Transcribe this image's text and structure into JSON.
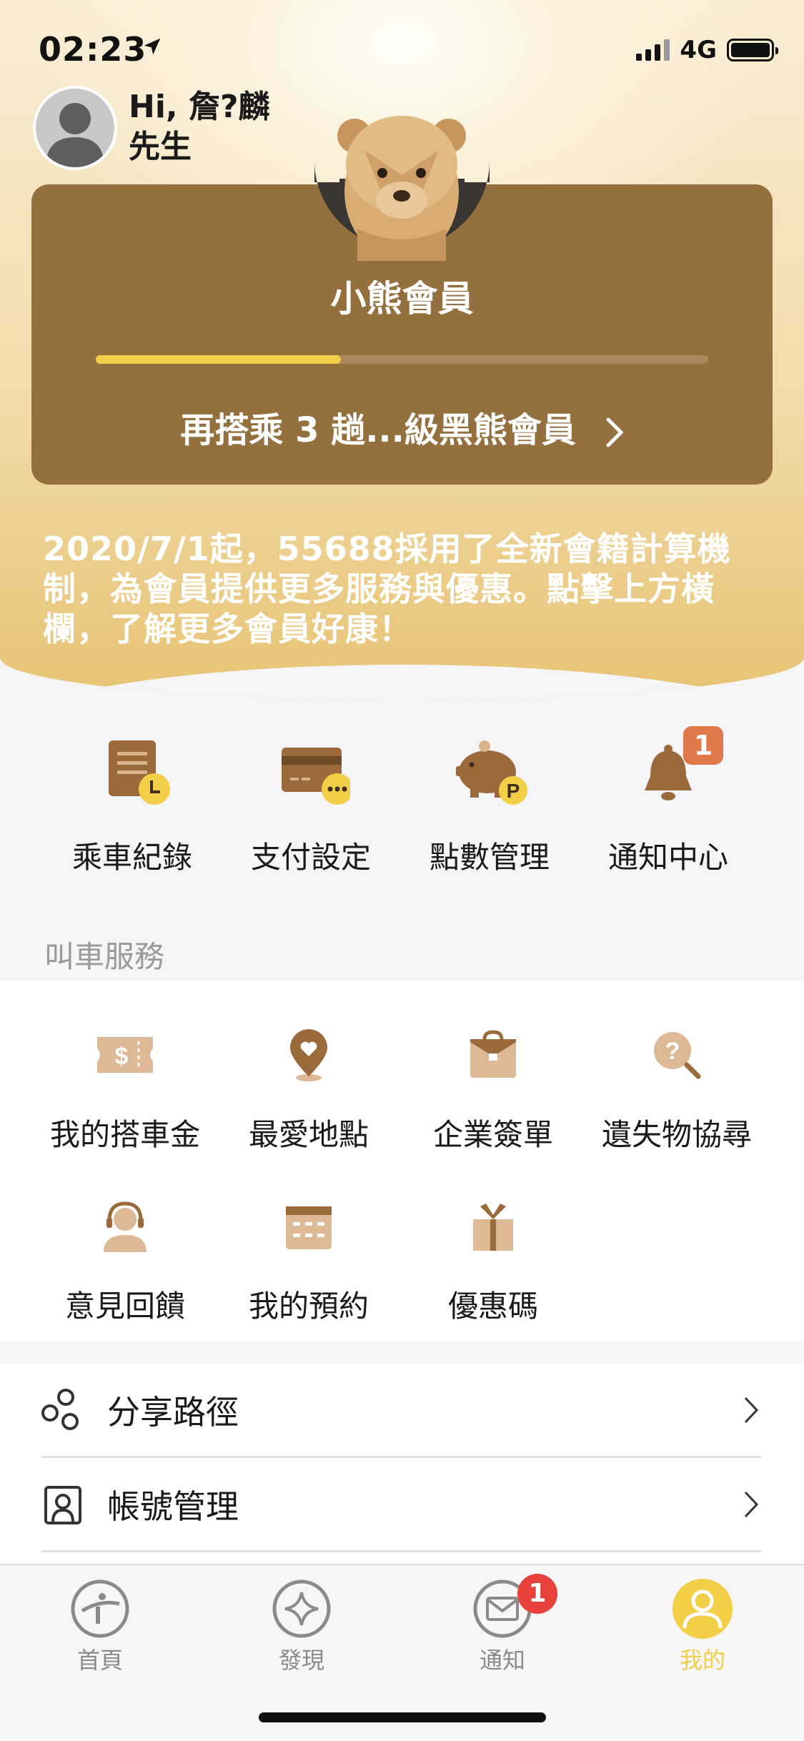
{
  "status_bar": {
    "time": "02:23",
    "network": "4G"
  },
  "header": {
    "greeting_line1": "Hi, 詹?麟",
    "greeting_line2": "先生"
  },
  "member_card": {
    "tier": "小熊會員",
    "progress": 0.4,
    "upgrade_text": "再搭乘 3 趟...級黑熊會員"
  },
  "notice": "2020/7/1起，55688採用了全新會籍計算機制，為會員提供更多服務與優惠。點擊上方橫欄，了解更多會員好康！",
  "quick_actions": [
    {
      "label": "乘車紀錄",
      "icon": "ride-record-icon"
    },
    {
      "label": "支付設定",
      "icon": "payment-card-icon"
    },
    {
      "label": "點數管理",
      "icon": "piggy-bank-icon"
    },
    {
      "label": "通知中心",
      "icon": "bell-icon",
      "badge": "1"
    }
  ],
  "services": {
    "title": "叫車服務",
    "items": [
      {
        "label": "我的搭車金",
        "icon": "ticket-dollar-icon"
      },
      {
        "label": "最愛地點",
        "icon": "heart-pin-icon"
      },
      {
        "label": "企業簽單",
        "icon": "briefcase-icon"
      },
      {
        "label": "遺失物協尋",
        "icon": "question-search-icon"
      },
      {
        "label": "意見回饋",
        "icon": "headset-person-icon"
      },
      {
        "label": "我的預約",
        "icon": "calendar-icon"
      },
      {
        "label": "優惠碼",
        "icon": "gift-icon"
      }
    ]
  },
  "list": [
    {
      "label": "分享路徑",
      "icon": "share-icon"
    },
    {
      "label": "帳號管理",
      "icon": "account-icon"
    }
  ],
  "tabs": [
    {
      "label": "首頁",
      "icon": "home-logo-icon"
    },
    {
      "label": "發現",
      "icon": "sparkle-icon"
    },
    {
      "label": "通知",
      "icon": "mail-icon",
      "badge": "1"
    },
    {
      "label": "我的",
      "icon": "profile-icon",
      "active": true
    }
  ],
  "colors": {
    "brand_brown": "#95703f",
    "accent_yellow": "#f2cf46",
    "icon_brown": "#9b6a3b",
    "badge_red": "#e8413b",
    "badge_orange": "#e0784a"
  }
}
